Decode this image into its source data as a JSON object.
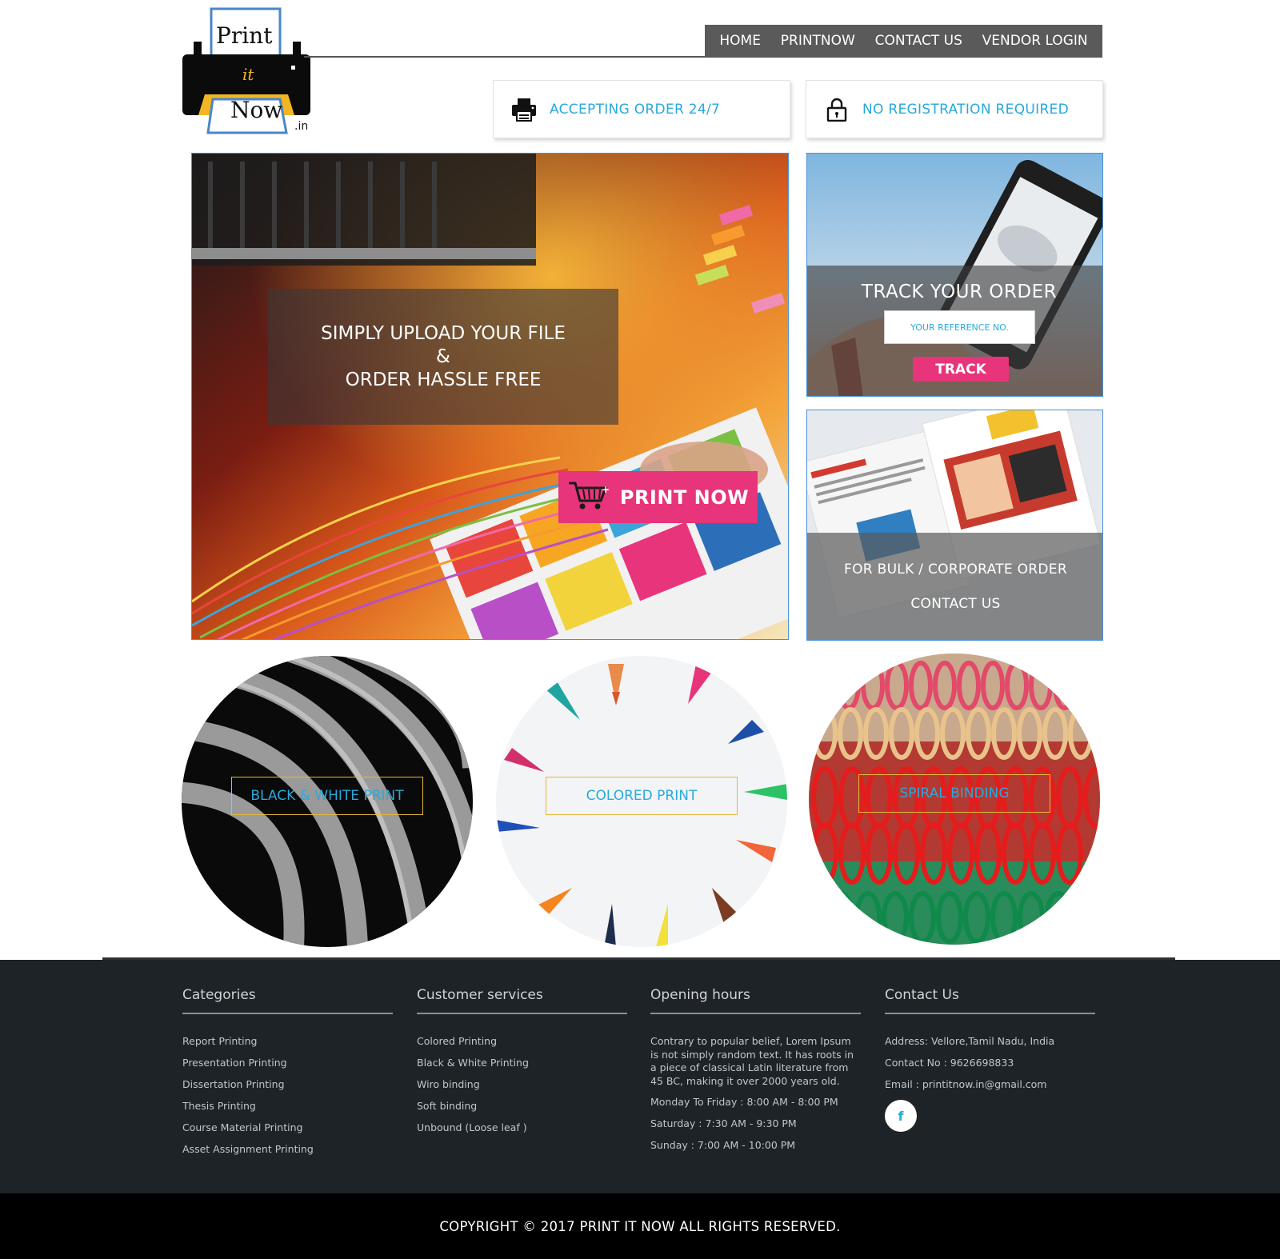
{
  "brand": {
    "logo_top": "Print",
    "logo_middle": "it",
    "logo_bottom": "Now",
    "logo_suffix": ".in",
    "accent_pink": "#e8347a",
    "accent_blue": "#29a9db",
    "accent_gold": "#e8b73a"
  },
  "nav": {
    "items": [
      "HOME",
      "PRINTNOW",
      "CONTACT US",
      "VENDOR LOGIN"
    ]
  },
  "features": [
    {
      "icon": "printer-icon",
      "label": "ACCEPTING ORDER 24/7"
    },
    {
      "icon": "lock-icon",
      "label": "NO REGISTRATION REQUIRED"
    }
  ],
  "hero": {
    "line1": "SIMPLY UPLOAD YOUR FILE",
    "line2": "&",
    "line3": "ORDER HASSLE FREE",
    "button_icon": "cart-icon",
    "button_label": "PRINT NOW"
  },
  "track": {
    "title": "TRACK YOUR ORDER",
    "placeholder": "YOUR REFERENCE NO.",
    "button_label": "TRACK"
  },
  "bulk": {
    "line1": "FOR BULK / CORPORATE ORDER",
    "line2": "CONTACT US"
  },
  "services": [
    {
      "label": "BLACK & WHITE PRINT"
    },
    {
      "label": "COLORED PRINT"
    },
    {
      "label": "SPIRAL BINDING"
    }
  ],
  "footer": {
    "categories": {
      "title": "Categories",
      "items": [
        "Report Printing",
        "Presentation Printing",
        "Dissertation Printing",
        "Thesis Printing",
        "Course Material Printing",
        "Asset Assignment Printing"
      ]
    },
    "customer_services": {
      "title": "Customer services",
      "items": [
        "Colored Printing",
        "Black & White Printing",
        "Wiro binding",
        "Soft binding",
        "Unbound (Loose leaf )"
      ]
    },
    "opening_hours": {
      "title": "Opening hours",
      "description": "Contrary to popular belief, Lorem Ipsum is not simply random text. It has roots in a piece of classical Latin literature from 45 BC, making it over 2000 years old.",
      "hours": [
        "Monday To Friday : 8:00 AM - 8:00 PM",
        "Saturday : 7:30 AM - 9:30 PM",
        "Sunday : 7:00 AM - 10:00 PM"
      ]
    },
    "contact": {
      "title": "Contact Us",
      "address": "Address: Vellore,Tamil Nadu, India",
      "phone": "Contact No : 9626698833",
      "email": "Email : printitnow.in@gmail.com",
      "social_icon": "facebook-icon",
      "social_glyph": "f"
    }
  },
  "copyright": "COPYRIGHT © 2017 PRINT IT NOW ALL RIGHTS RESERVED."
}
